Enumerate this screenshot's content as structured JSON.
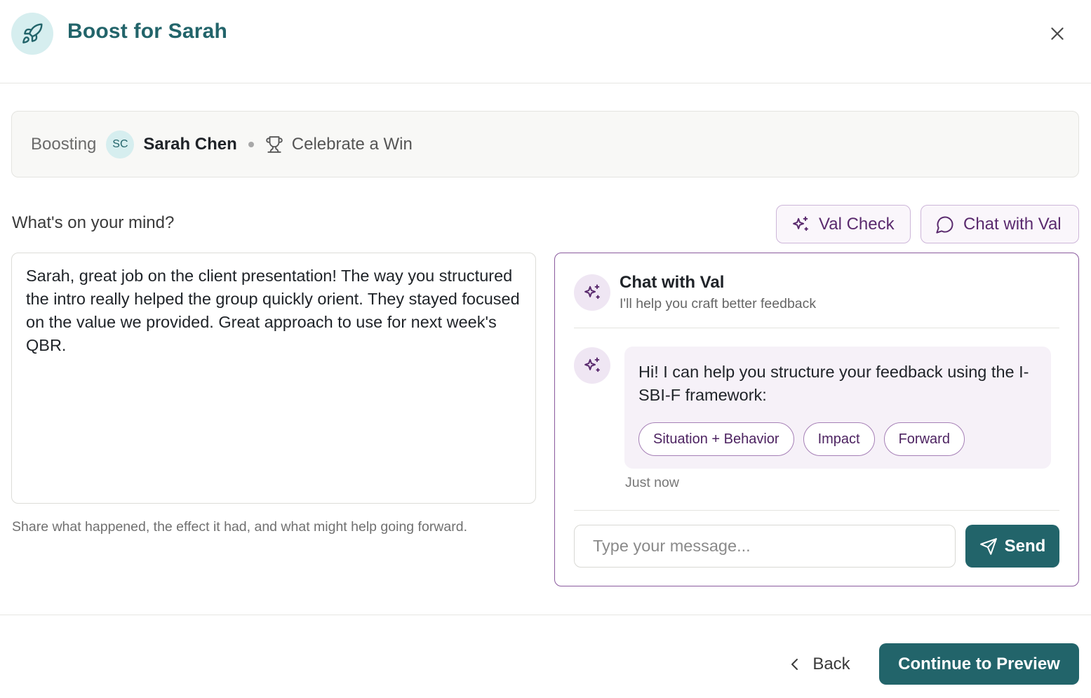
{
  "header": {
    "title": "Boost for Sarah",
    "icon": "rocket-icon",
    "close_icon": "close-icon"
  },
  "context": {
    "label": "Boosting",
    "recipient_initials": "SC",
    "recipient_name": "Sarah Chen",
    "type_icon": "trophy-icon",
    "boost_type": "Celebrate a Win"
  },
  "composer": {
    "prompt_label": "What's on your mind?",
    "feedback_text": "Sarah, great job on the client presentation! The way you structured the intro really helped the group quickly orient. They stayed focused on the value we provided. Great approach to use for next week's QBR.",
    "hint": "Share what happened, the effect it had, and what might help going forward."
  },
  "actions": {
    "val_check_label": "Val Check",
    "val_check_icon": "sparkles-icon",
    "chat_label": "Chat with Val",
    "chat_icon": "chat-bubble-icon"
  },
  "chat": {
    "title": "Chat with Val",
    "subtitle": "I'll help you craft better feedback",
    "messages": [
      {
        "sender": "Val",
        "text": "Hi! I can help you structure your feedback using the I-SBI-F framework:",
        "chips": [
          "Situation + Behavior",
          "Impact",
          "Forward"
        ],
        "time": "Just now"
      }
    ],
    "input_placeholder": "Type your message...",
    "send_label": "Send",
    "send_icon": "send-icon"
  },
  "footer": {
    "back_label": "Back",
    "continue_label": "Continue to Preview"
  },
  "colors": {
    "brand_teal": "#22646a",
    "accent_purple": "#5a2a6e",
    "panel_border": "#8a5a9e"
  }
}
